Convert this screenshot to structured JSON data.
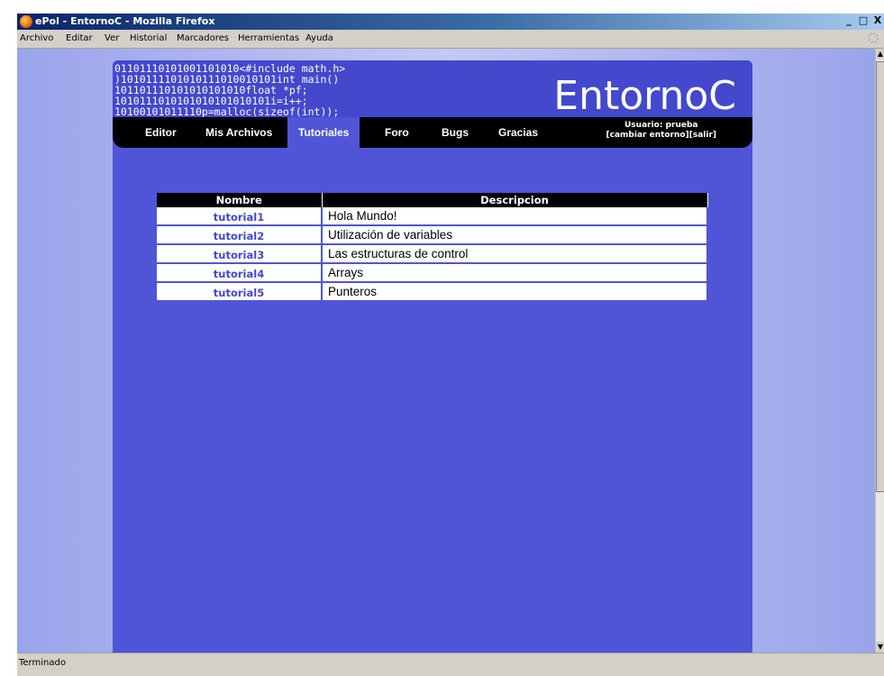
{
  "window": {
    "title": "ePol - EntornoC - Mozilla Firefox",
    "controls": [
      "_",
      "□",
      "X"
    ]
  },
  "menu": [
    "Archivo",
    "Editar",
    "Ver",
    "Historial",
    "Marcadores",
    "Herramientas",
    "Ayuda"
  ],
  "status": "Terminado",
  "site": {
    "code_lines": [
      "01101110101001101010<#include math.h>",
      ")1010111101010111010010101int main()",
      "101101110101010101010float *pf;",
      "1010111010101010101010101i=i++;",
      "10100101011110p=malloc(sizeof(int));"
    ],
    "brand": "EntornoC",
    "nav": [
      "Editor",
      "Mis Archivos",
      "Tutoriales",
      "Foro",
      "Bugs",
      "Gracias"
    ],
    "active_nav": "Tutoriales",
    "user_label": "Usuario: prueba",
    "user_links": "[cambiar entorno][salir]"
  },
  "table": {
    "headers": [
      "Nombre",
      "Descripcion"
    ],
    "rows": [
      {
        "name": "tutorial1",
        "desc": "Hola Mundo!"
      },
      {
        "name": "tutorial2",
        "desc": "Utilización de variables"
      },
      {
        "name": "tutorial3",
        "desc": "Las estructuras de control"
      },
      {
        "name": "tutorial4",
        "desc": "Arrays"
      },
      {
        "name": "tutorial5",
        "desc": "Punteros"
      }
    ]
  },
  "colors": {
    "page_bg": "#4f55d6",
    "header_bg": "#4348cc",
    "navbar_bg": "#000000",
    "link": "#4348cc"
  }
}
